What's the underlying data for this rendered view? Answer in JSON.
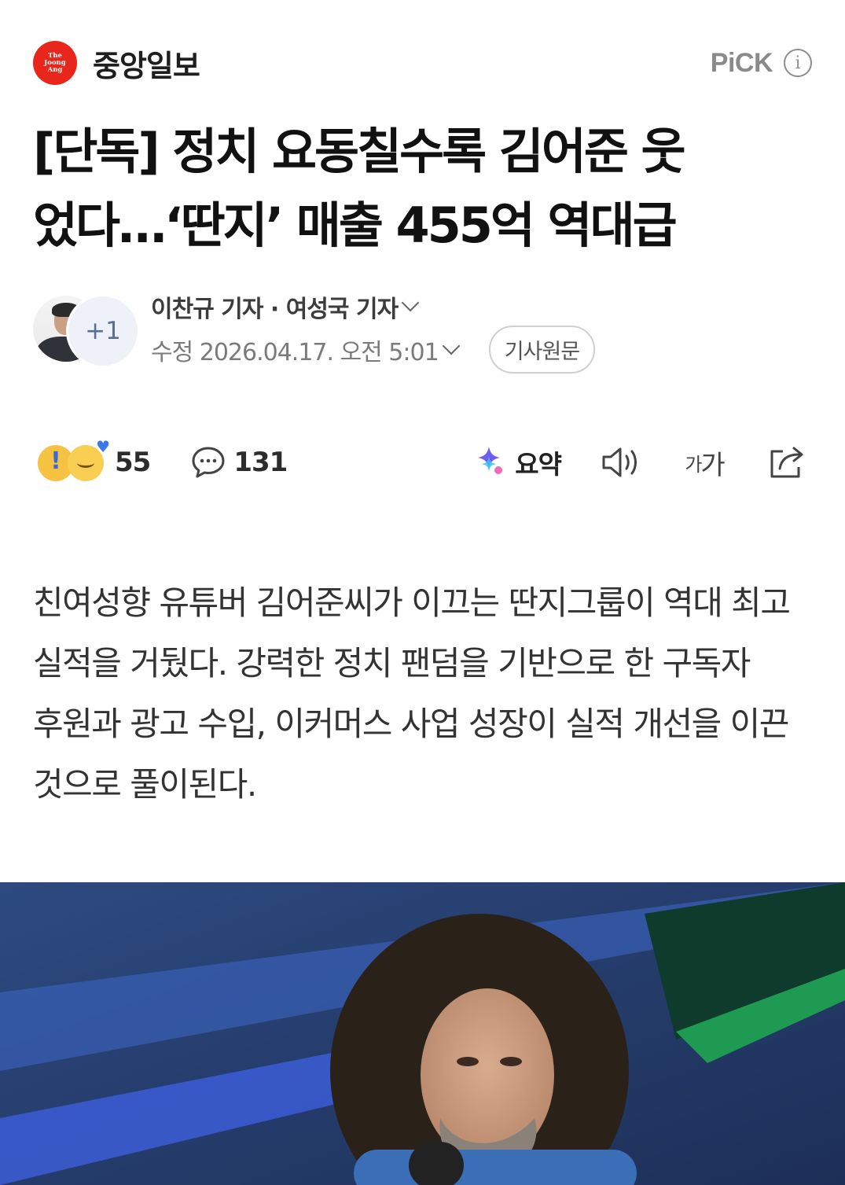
{
  "header": {
    "logo_text": [
      "The",
      "Joong",
      "Ang"
    ],
    "press_name": "중앙일보",
    "pick_label": "PiCK",
    "info_icon": "info-icon"
  },
  "article": {
    "title_line1": "[단독] 정치 요동칠수록 김어준 웃",
    "title_line2": "었다…‘딴지’ 매출 455억 역대급",
    "reporters": "이찬규 기자 · 여성국 기자",
    "extra_reporters": "+1",
    "updated": "수정 2026.04.17. 오전 5:01",
    "origin_button": "기사원문",
    "body": "친여성향 유튜버 김어준씨가 이끄는 딴지그룹이 역대 최고 실적을 거뒀다. 강력한 정치 팬덤을 기반으로 한 구독자 후원과 광고 수입, 이커머스 사업 성장이 실적 개선을 이끈 것으로 풀이된다."
  },
  "toolbar": {
    "reaction_count": "55",
    "comment_count": "131",
    "summary_label": "요약",
    "font_size_label_small": "가",
    "font_size_label_large": "가",
    "icons": [
      "reaction-icon",
      "comment-icon",
      "summary-icon",
      "speaker-icon",
      "font-size-icon",
      "share-icon"
    ]
  },
  "colors": {
    "brand_red": "#e8261c",
    "text_primary": "#111111",
    "text_secondary": "#7b7b7b",
    "photo_background": "#2e4778"
  }
}
